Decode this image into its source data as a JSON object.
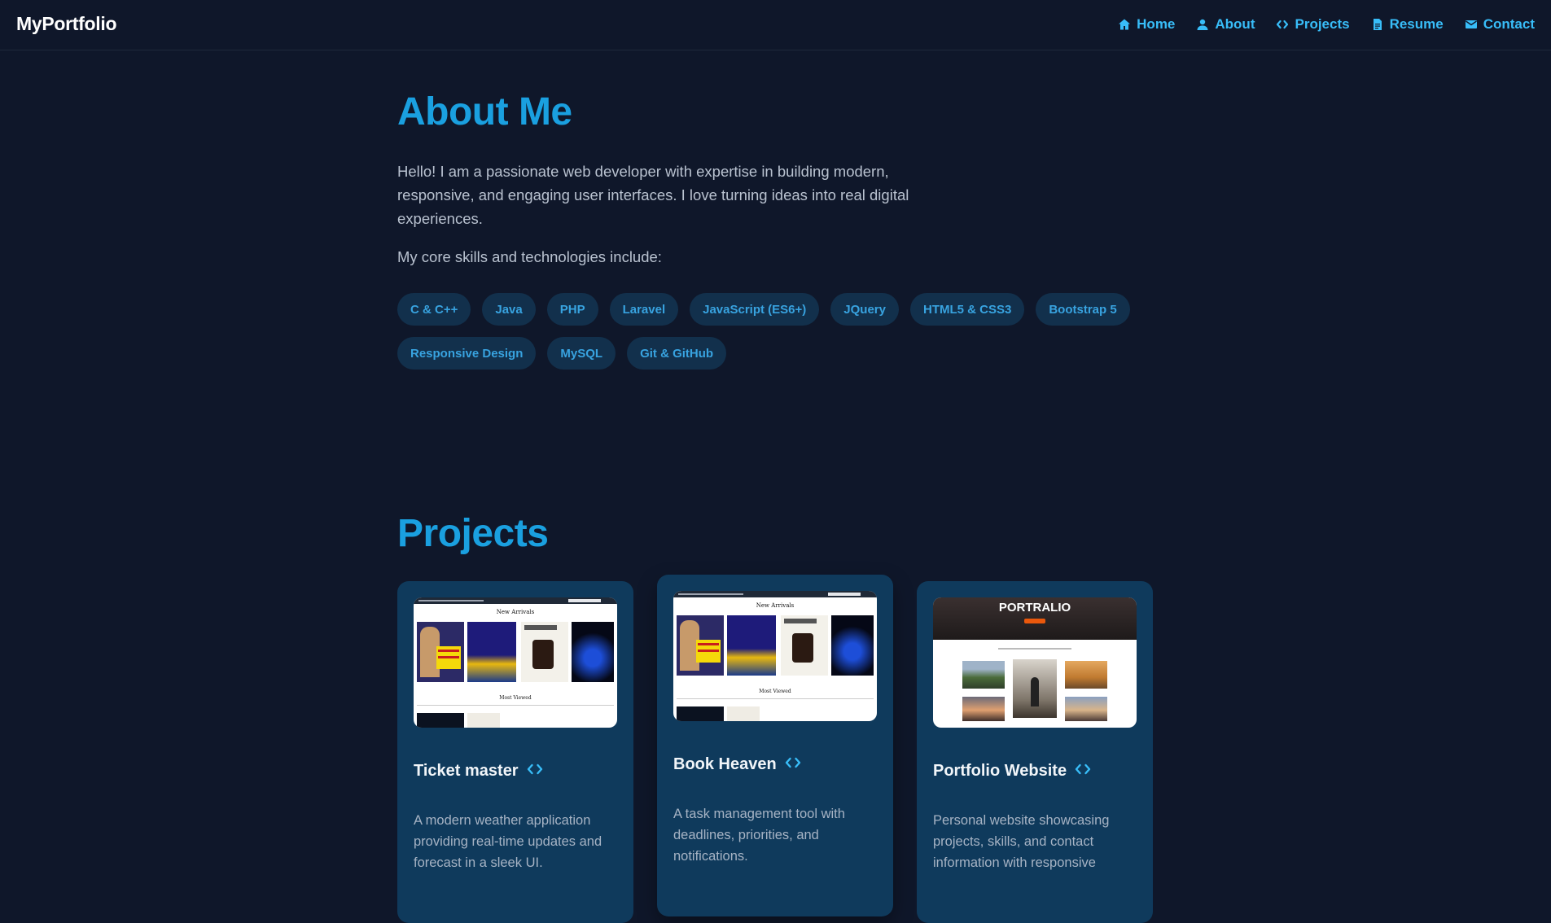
{
  "navbar": {
    "brand": "MyPortfolio",
    "links": [
      {
        "label": "Home",
        "icon": "home-icon"
      },
      {
        "label": "About",
        "icon": "user-icon"
      },
      {
        "label": "Projects",
        "icon": "code-icon"
      },
      {
        "label": "Resume",
        "icon": "document-icon"
      },
      {
        "label": "Contact",
        "icon": "mail-icon"
      }
    ]
  },
  "about": {
    "title": "About Me",
    "paragraph": "Hello! I am a passionate web developer with expertise in building modern, responsive, and engaging user interfaces. I love turning ideas into real digital experiences.",
    "skills_intro": "My core skills and technologies include:",
    "skills": [
      "C & C++",
      "Java",
      "PHP",
      "Laravel",
      "JavaScript (ES6+)",
      "JQuery",
      "HTML5 & CSS3",
      "Bootstrap 5",
      "Responsive Design",
      "MySQL",
      "Git & GitHub"
    ]
  },
  "projects": {
    "title": "Projects",
    "items": [
      {
        "title": "Ticket master",
        "description": "A modern weather application providing real-time updates and forecast in a sleek UI.",
        "thumb": {
          "heading": "New Arrivals",
          "heading2": "Most Viewed"
        }
      },
      {
        "title": "Book Heaven",
        "description": "A task management tool with deadlines, priorities, and notifications.",
        "thumb": {
          "heading": "New Arrivals",
          "heading2": "Most Viewed"
        }
      },
      {
        "title": "Portfolio Website",
        "description": "Personal website showcasing projects, skills, and contact information with responsive",
        "thumb": {
          "heading": "PORTRALIO"
        }
      }
    ]
  },
  "colors": {
    "background": "#0f172a",
    "accent": "#38bdf8",
    "heading": "#1aa0e0",
    "card": "#0f3a5c",
    "chip": "#12304c"
  }
}
